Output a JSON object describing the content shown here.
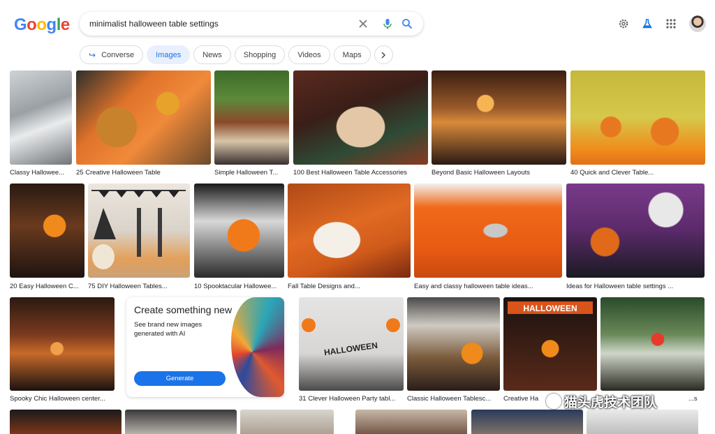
{
  "logo": {
    "letters": [
      "G",
      "o",
      "o",
      "g",
      "l",
      "e"
    ],
    "colors": [
      "#4285F4",
      "#EA4335",
      "#FBBC05",
      "#4285F4",
      "#34A853",
      "#EA4335"
    ]
  },
  "search": {
    "query": "minimalist halloween table settings"
  },
  "chips": {
    "converse": "Converse",
    "images": "Images",
    "news": "News",
    "shopping": "Shopping",
    "videos": "Videos",
    "maps": "Maps"
  },
  "captions": {
    "r1": [
      "Classy Hallowee...",
      "25 Creative Halloween Table",
      "Simple Halloween T...",
      "100 Best Halloween Table Accessories",
      "Beyond Basic Halloween Layouts",
      "40 Quick and Clever Table..."
    ],
    "r2": [
      "20 Easy Halloween C...",
      "75 DIY Halloween Tables...",
      "10 Spooktacular Hallowee...",
      "Fall Table Designs and...",
      "Easy and classy halloween table ideas...",
      "Ideas for Halloween table settings ..."
    ],
    "r3": [
      "Spooky Chic Halloween center...",
      "31 Clever Halloween Party tabl...",
      "Classic Halloween Tablesc...",
      "Creative Ha",
      "...s"
    ]
  },
  "ai_card": {
    "title": "Create something new",
    "subtitle": "See brand new images generated with AI",
    "button": "Generate"
  },
  "image_text": {
    "halloween_banner": "HALLOWEEN",
    "halloween_sign": "HALLOWEEN"
  },
  "watermark": "猫头虎技术团队"
}
